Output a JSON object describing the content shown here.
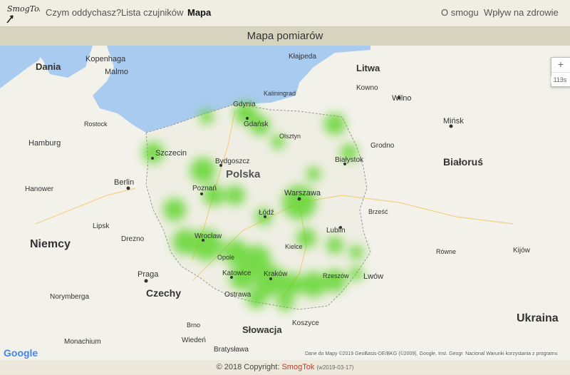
{
  "nav": {
    "logo_text": "SmogTok",
    "links": [
      "Czym oddychasz?",
      "Lista czujników",
      "Mapa",
      "O smogu",
      "Wpływ na zdrowie"
    ],
    "active": "Mapa"
  },
  "page_title": "Mapa pomiarów",
  "map": {
    "countries": [
      "Polska",
      "Niemcy",
      "Czechy",
      "Słowacja",
      "Litwa",
      "Białoruś",
      "Ukraina",
      "Dania"
    ],
    "cities": [
      "Gdańsk",
      "Gdynia",
      "Szczecin",
      "Bydgoszcz",
      "Poznań",
      "Warszawa",
      "Łódź",
      "Wrocław",
      "Katowice",
      "Kraków",
      "Lublin",
      "Białystok",
      "Olsztyn",
      "Kielce",
      "Rzeszów",
      "Opole",
      "Kaliningrad",
      "Kłajpeda",
      "Kowno",
      "Wilno",
      "Mińsk",
      "Berlin",
      "Hamburg",
      "Praga",
      "Ostrawa",
      "Brześć",
      "Lwów",
      "Koszyce",
      "Bratysława",
      "Wiedeń",
      "Grodno",
      "Kopenhaga",
      "Malmo",
      "Rostock",
      "Drezno",
      "Lipsk",
      "Hanower",
      "Norymberga",
      "Monachium",
      "Brno",
      "Równe",
      "Kijów"
    ],
    "zoom_in": "+",
    "zoom_out": "−",
    "zoom_level": "113s",
    "google_logo": "Google",
    "attribution": "Dane do Mapy ©2019 GeoBasis-DE/BKG (©2009), Google, Inst. Geogr. Nacional   Warunki korzystania z programu",
    "colors": {
      "sea": "#a9cbf0",
      "land": "#f2f1ea",
      "heat": "#4fd318"
    }
  },
  "footer": {
    "copyright": "© 2018 Copyright:",
    "brand": "SmogTok",
    "version": "(w2019-03-17)"
  }
}
